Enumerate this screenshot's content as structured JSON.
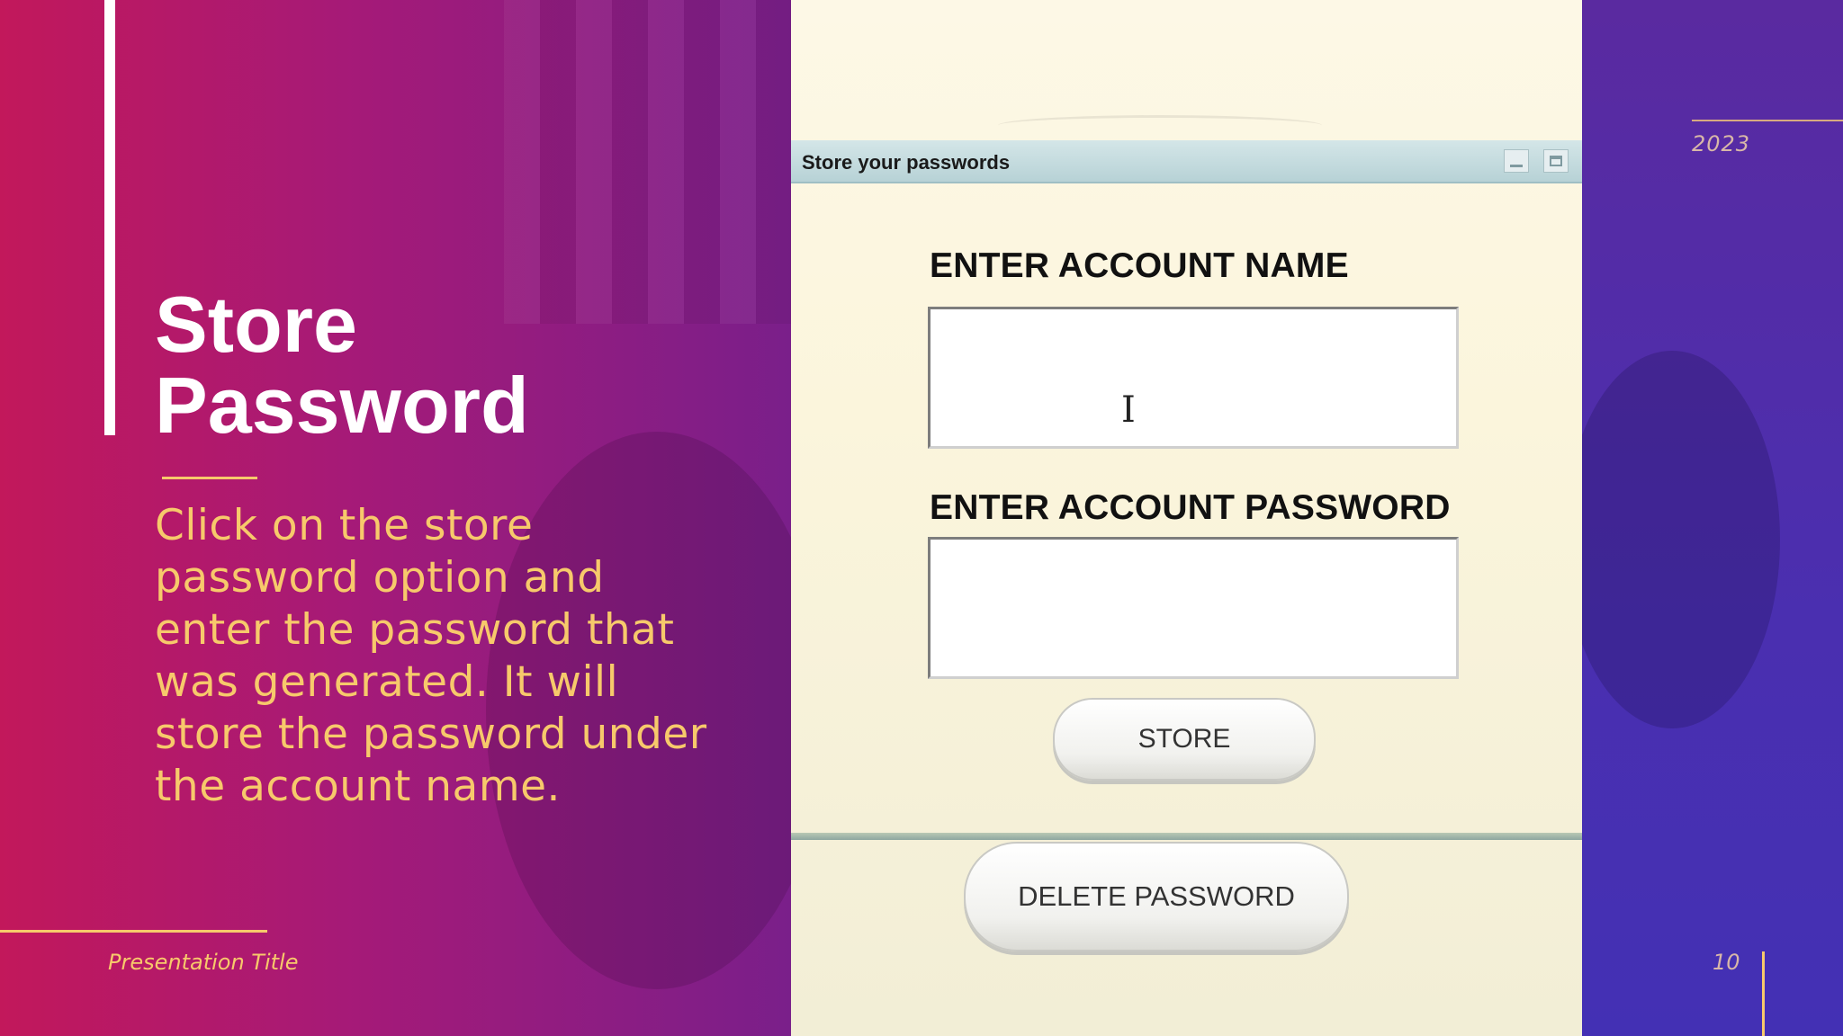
{
  "slide": {
    "title_line1": "Store",
    "title_line2": "Password",
    "body": "Click on the store password option and enter the password that was generated. It will store the password under the account name.",
    "footer_title": "Presentation Title",
    "year": "2023",
    "page_number": "10"
  },
  "app_window": {
    "title": "Store your passwords",
    "icons": [
      "minimize-icon",
      "maximize-icon"
    ],
    "account_name_label": "ENTER ACCOUNT NAME",
    "account_name_value": "",
    "account_password_label": "ENTER ACCOUNT PASSWORD",
    "account_password_value": "",
    "store_button": "STORE",
    "delete_button": "DELETE PASSWORD",
    "cursor_glyph": "I"
  },
  "colors": {
    "left_gradient_start": "#c2185b",
    "left_gradient_end": "#7a1f8a",
    "right_panel": "#4a2fb0",
    "accent_gold": "#f7c96b",
    "title_white": "#ffffff"
  }
}
